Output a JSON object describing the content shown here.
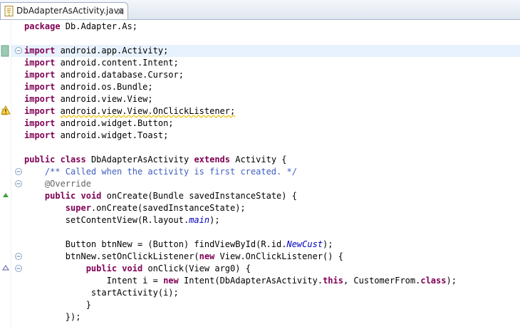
{
  "editor": {
    "tab_title": "DbAdapterAsActivity.java",
    "icons": {
      "file": "java-file-icon",
      "close": "close-icon",
      "fold": "fold-icon",
      "override": "override-arrow-icon",
      "implements": "implements-arrow-icon",
      "warning": "warning-icon",
      "bookmark": "quick-diff-icon"
    },
    "colors": {
      "keyword": "#7f0055",
      "comment": "#3f5fbf",
      "annotation": "#646464",
      "field": "#0000c0",
      "current_line": "#e8f2fe"
    }
  },
  "code": {
    "line1": {
      "kw": "package",
      "text": " Db.Adapter.As;"
    },
    "line3": {
      "kw": "import",
      "text": " android.app.Activity;"
    },
    "line4": {
      "kw": "import",
      "text": " android.content.Intent;"
    },
    "line5": {
      "kw": "import",
      "text": " android.database.Cursor;"
    },
    "line6": {
      "kw": "import",
      "text": " android.os.Bundle;"
    },
    "line7": {
      "kw": "import",
      "text": " android.view.View;"
    },
    "line8": {
      "kw": "import",
      "text": "android.view.View.OnClickListener;"
    },
    "line9": {
      "kw": "import",
      "text": " android.widget.Button;"
    },
    "line10": {
      "kw": "import",
      "text": " android.widget.Toast;"
    },
    "line12": {
      "kw1": "public",
      "kw2": "class",
      "name": " DbAdapterAsActivity ",
      "kw3": "extends",
      "text": " Activity {"
    },
    "line13": {
      "comment": "/** Called when the activity is first created. */"
    },
    "line14": {
      "annotation": "@Override"
    },
    "line15": {
      "kw1": "public",
      "kw2": "void",
      "text": " onCreate(Bundle savedInstanceState) {"
    },
    "line16": {
      "kw": "super",
      "text": ".onCreate(savedInstanceState);"
    },
    "line17": {
      "text": "setContentView(R.layout.",
      "field": "main",
      "tail": ");"
    },
    "line19": {
      "text": "Button btnNew = (Button) findViewById(R.id.",
      "field": "NewCust",
      "tail": ");"
    },
    "line20": {
      "text": "btnNew.setOnClickListener(",
      "kw": "new",
      "tail": " View.OnClickListener() {"
    },
    "line21": {
      "kw1": "public",
      "kw2": "void",
      "text": " onClick(View arg0) {"
    },
    "line22": {
      "text": "Intent i = ",
      "kw": "new",
      "mid": " Intent(DbAdapterAsActivity.",
      "kw2": "this",
      "mid2": ", CustomerFrom.",
      "kw3": "class",
      "tail": ");"
    },
    "line23": {
      "text": "startActivity(i);"
    },
    "line24": {
      "text": "}"
    },
    "line25": {
      "text": "});"
    }
  }
}
